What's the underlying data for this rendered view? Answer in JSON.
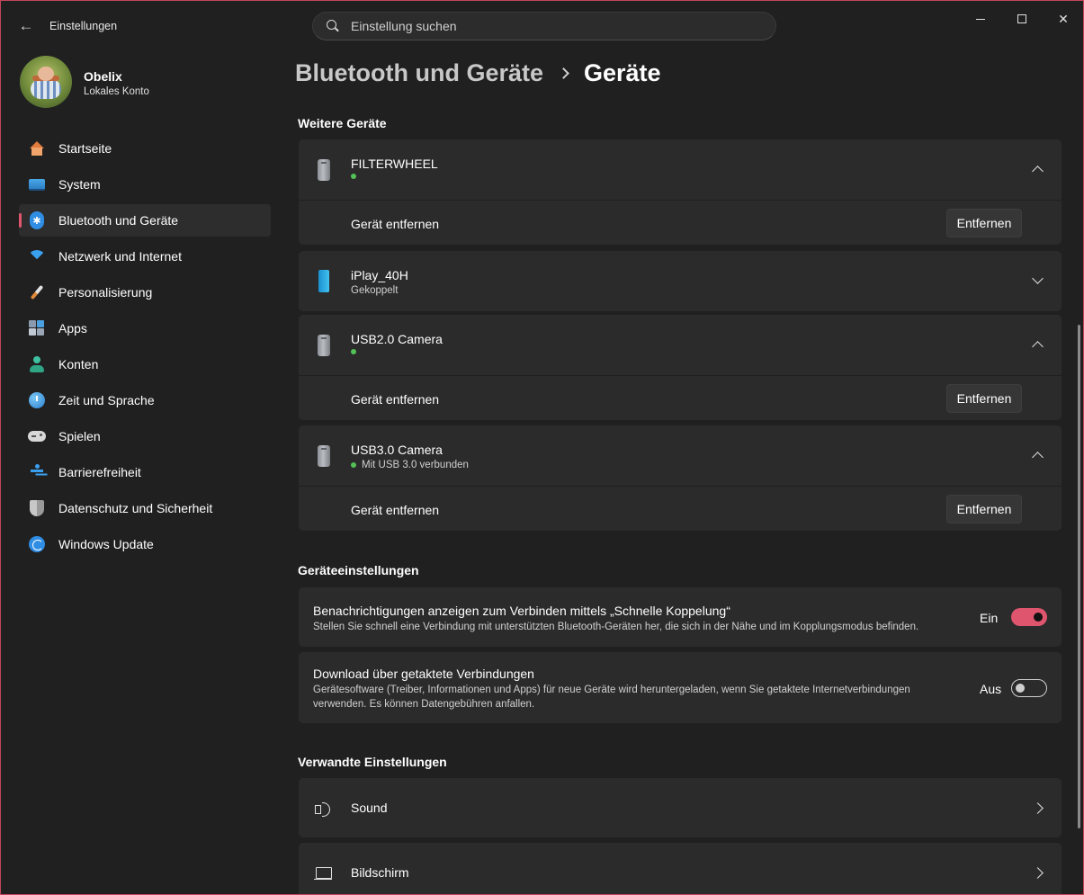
{
  "window": {
    "app_title": "Einstellungen",
    "search_placeholder": "Einstellung suchen",
    "accent": "#e0556e"
  },
  "profile": {
    "name": "Obelix",
    "account_type": "Lokales Konto"
  },
  "sidebar": {
    "items": [
      {
        "label": "Startseite",
        "icon": "home-icon"
      },
      {
        "label": "System",
        "icon": "system-icon"
      },
      {
        "label": "Bluetooth und Geräte",
        "icon": "bluetooth-icon",
        "active": true
      },
      {
        "label": "Netzwerk und Internet",
        "icon": "wifi-icon"
      },
      {
        "label": "Personalisierung",
        "icon": "brush-icon"
      },
      {
        "label": "Apps",
        "icon": "apps-icon"
      },
      {
        "label": "Konten",
        "icon": "account-icon"
      },
      {
        "label": "Zeit und Sprache",
        "icon": "time-language-icon"
      },
      {
        "label": "Spielen",
        "icon": "gamepad-icon"
      },
      {
        "label": "Barrierefreiheit",
        "icon": "accessibility-icon"
      },
      {
        "label": "Datenschutz und Sicherheit",
        "icon": "shield-icon"
      },
      {
        "label": "Windows Update",
        "icon": "update-icon"
      }
    ]
  },
  "breadcrumb": {
    "parent": "Bluetooth und Geräte",
    "current": "Geräte"
  },
  "other_devices": {
    "title": "Weitere Geräte",
    "devices": [
      {
        "name": "FILTERWHEEL",
        "status": "",
        "expanded": true,
        "sub_label": "Gerät entfernen",
        "button": "Entfernen"
      },
      {
        "name": "iPlay_40H",
        "status": "Gekoppelt",
        "expanded": false
      },
      {
        "name": "USB2.0 Camera",
        "status": "",
        "expanded": true,
        "sub_label": "Gerät entfernen",
        "button": "Entfernen"
      },
      {
        "name": "USB3.0 Camera",
        "status": "Mit USB 3.0 verbunden",
        "expanded": true,
        "sub_label": "Gerät entfernen",
        "button": "Entfernen"
      }
    ]
  },
  "device_settings": {
    "title": "Geräteeinstellungen",
    "items": [
      {
        "title": "Benachrichtigungen anzeigen zum Verbinden mittels „Schnelle Koppelung“",
        "description": "Stellen Sie schnell eine Verbindung mit unterstützten Bluetooth-Geräten her, die sich in der Nähe und im Kopplungsmodus befinden.",
        "toggle_label": "Ein",
        "on": true
      },
      {
        "title": "Download über getaktete Verbindungen",
        "description": "Gerätesoftware (Treiber, Informationen und Apps) für neue Geräte wird heruntergeladen, wenn Sie getaktete Internetverbindungen verwenden. Es können Datengebühren anfallen.",
        "toggle_label": "Aus",
        "on": false
      }
    ]
  },
  "related_settings": {
    "title": "Verwandte Einstellungen",
    "items": [
      {
        "label": "Sound",
        "icon": "speaker-icon"
      },
      {
        "label": "Bildschirm",
        "icon": "monitor-icon"
      }
    ]
  }
}
